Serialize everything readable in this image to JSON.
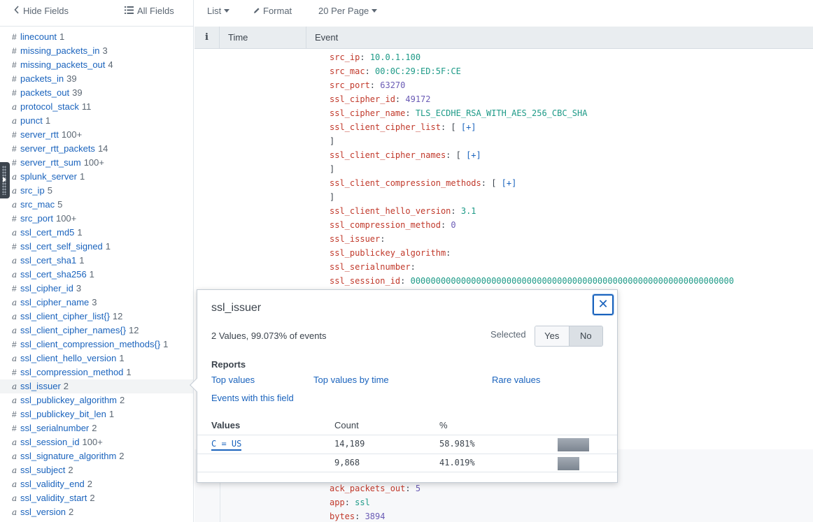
{
  "sidebar": {
    "hide_fields": "Hide Fields",
    "all_fields": "All Fields",
    "fields": [
      {
        "type": "#",
        "name": "linecount",
        "count": "1"
      },
      {
        "type": "#",
        "name": "missing_packets_in",
        "count": "3"
      },
      {
        "type": "#",
        "name": "missing_packets_out",
        "count": "4"
      },
      {
        "type": "#",
        "name": "packets_in",
        "count": "39"
      },
      {
        "type": "#",
        "name": "packets_out",
        "count": "39"
      },
      {
        "type": "a",
        "name": "protocol_stack",
        "count": "11"
      },
      {
        "type": "a",
        "name": "punct",
        "count": "1"
      },
      {
        "type": "#",
        "name": "server_rtt",
        "count": "100+"
      },
      {
        "type": "#",
        "name": "server_rtt_packets",
        "count": "14"
      },
      {
        "type": "#",
        "name": "server_rtt_sum",
        "count": "100+"
      },
      {
        "type": "a",
        "name": "splunk_server",
        "count": "1"
      },
      {
        "type": "a",
        "name": "src_ip",
        "count": "5"
      },
      {
        "type": "a",
        "name": "src_mac",
        "count": "5"
      },
      {
        "type": "#",
        "name": "src_port",
        "count": "100+"
      },
      {
        "type": "a",
        "name": "ssl_cert_md5",
        "count": "1"
      },
      {
        "type": "#",
        "name": "ssl_cert_self_signed",
        "count": "1"
      },
      {
        "type": "a",
        "name": "ssl_cert_sha1",
        "count": "1"
      },
      {
        "type": "a",
        "name": "ssl_cert_sha256",
        "count": "1"
      },
      {
        "type": "#",
        "name": "ssl_cipher_id",
        "count": "3"
      },
      {
        "type": "a",
        "name": "ssl_cipher_name",
        "count": "3"
      },
      {
        "type": "a",
        "name": "ssl_client_cipher_list{}",
        "count": "12"
      },
      {
        "type": "a",
        "name": "ssl_client_cipher_names{}",
        "count": "12"
      },
      {
        "type": "#",
        "name": "ssl_client_compression_methods{}",
        "count": "1"
      },
      {
        "type": "a",
        "name": "ssl_client_hello_version",
        "count": "1"
      },
      {
        "type": "#",
        "name": "ssl_compression_method",
        "count": "1"
      },
      {
        "type": "a",
        "name": "ssl_issuer",
        "count": "2"
      },
      {
        "type": "a",
        "name": "ssl_publickey_algorithm",
        "count": "2"
      },
      {
        "type": "#",
        "name": "ssl_publickey_bit_len",
        "count": "1"
      },
      {
        "type": "#",
        "name": "ssl_serialnumber",
        "count": "2"
      },
      {
        "type": "a",
        "name": "ssl_session_id",
        "count": "100+"
      },
      {
        "type": "a",
        "name": "ssl_signature_algorithm",
        "count": "2"
      },
      {
        "type": "a",
        "name": "ssl_subject",
        "count": "2"
      },
      {
        "type": "a",
        "name": "ssl_validity_end",
        "count": "2"
      },
      {
        "type": "a",
        "name": "ssl_validity_start",
        "count": "2"
      },
      {
        "type": "a",
        "name": "ssl_version",
        "count": "2"
      }
    ]
  },
  "toolbar": {
    "list": "List",
    "format": "Format",
    "per_page": "20 Per Page"
  },
  "table": {
    "info": "i",
    "time": "Time",
    "event": "Event"
  },
  "event_lines": [
    {
      "key": "src_ip",
      "sep": ": ",
      "value": "10.0.1.100",
      "vt": "s"
    },
    {
      "key": "src_mac",
      "sep": ": ",
      "value": "00:0C:29:ED:5F:CE",
      "vt": "s"
    },
    {
      "key": "src_port",
      "sep": ": ",
      "value": "63270",
      "vt": "n"
    },
    {
      "key": "ssl_cipher_id",
      "sep": ": ",
      "value": "49172",
      "vt": "n"
    },
    {
      "key": "ssl_cipher_name",
      "sep": ": ",
      "value": "TLS_ECDHE_RSA_WITH_AES_256_CBC_SHA",
      "vt": "s"
    },
    {
      "key": "ssl_client_cipher_list",
      "sep": ": [ ",
      "value": "[+]",
      "vt": "b"
    },
    {
      "key": "",
      "sep": "]",
      "value": "",
      "vt": "s"
    },
    {
      "key": "ssl_client_cipher_names",
      "sep": ": [ ",
      "value": "[+]",
      "vt": "b"
    },
    {
      "key": "",
      "sep": "]",
      "value": "",
      "vt": "s"
    },
    {
      "key": "ssl_client_compression_methods",
      "sep": ": [ ",
      "value": "[+]",
      "vt": "b"
    },
    {
      "key": "",
      "sep": "]",
      "value": "",
      "vt": "s"
    },
    {
      "key": "ssl_client_hello_version",
      "sep": ": ",
      "value": "3.1",
      "vt": "s"
    },
    {
      "key": "ssl_compression_method",
      "sep": ": ",
      "value": "0",
      "vt": "n"
    },
    {
      "key": "ssl_issuer",
      "sep": ":",
      "value": "",
      "vt": "s"
    },
    {
      "key": "ssl_publickey_algorithm",
      "sep": ":",
      "value": "",
      "vt": "s"
    },
    {
      "key": "ssl_serialnumber",
      "sep": ":",
      "value": "",
      "vt": "s"
    },
    {
      "key": "ssl_session_id",
      "sep": ": ",
      "value": "0000000000000000000000000000000000000000000000000000000000000000",
      "vt": "s"
    }
  ],
  "event_lines_lower": [
    {
      "key": "ack_packets_out",
      "sep": ": ",
      "value": "5",
      "vt": "n"
    },
    {
      "key": "app",
      "sep": ": ",
      "value": "ssl",
      "vt": "s"
    },
    {
      "key": "bytes",
      "sep": ": ",
      "value": "3894",
      "vt": "n"
    }
  ],
  "popover": {
    "title": "ssl_issuer",
    "close": "✕",
    "summary": "2 Values, 99.073% of events",
    "selected_label": "Selected",
    "yes": "Yes",
    "no": "No",
    "reports_heading": "Reports",
    "reports": [
      "Top values",
      "Top values by time",
      "Rare values",
      "Events with this field"
    ],
    "values_header": "Values",
    "count_header": "Count",
    "pct_header": "%",
    "rows": [
      {
        "value": "C = US",
        "count": "14,189",
        "pct": "58.981%",
        "fraction": 0.58981
      },
      {
        "value": "",
        "count": "9,868",
        "pct": "41.019%",
        "fraction": 0.41019
      }
    ]
  }
}
